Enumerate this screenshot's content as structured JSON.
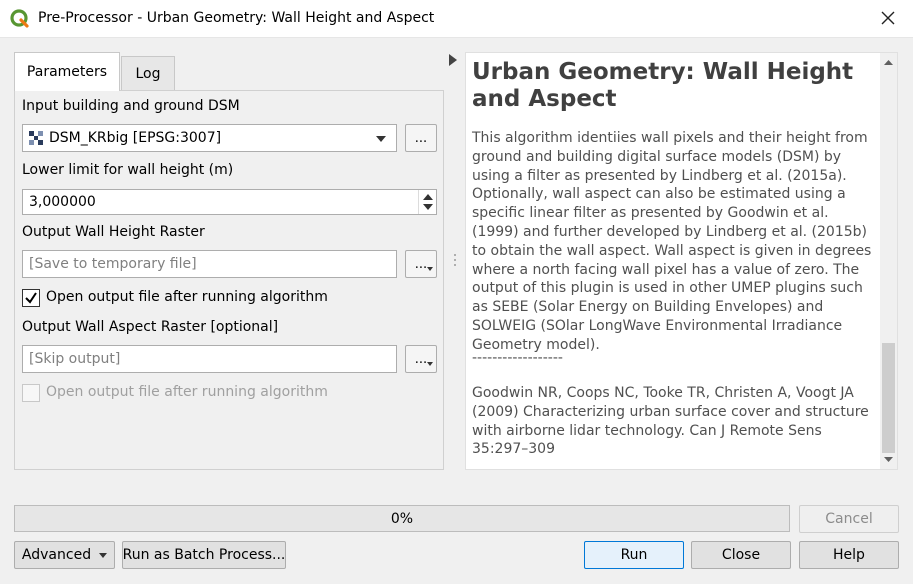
{
  "window": {
    "title": "Pre-Processor - Urban Geometry: Wall Height and Aspect"
  },
  "tabs": [
    {
      "label": "Parameters",
      "active": true
    },
    {
      "label": "Log",
      "active": false
    }
  ],
  "params": {
    "dsm_label": "Input building and ground DSM",
    "dsm_value": "DSM_KRbig [EPSG:3007]",
    "lower_limit_label": "Lower limit for wall height (m)",
    "lower_limit_value": "3,000000",
    "wall_height_label": "Output Wall Height Raster",
    "wall_height_placeholder": "[Save to temporary file]",
    "open_output_1": "Open output file after running algorithm",
    "wall_aspect_label": "Output Wall Aspect Raster [optional]",
    "wall_aspect_placeholder": "[Skip output]",
    "open_output_2": "Open output file after running algorithm",
    "browse_label": "..."
  },
  "help": {
    "title": "Urban Geometry: Wall Height and Aspect",
    "body": "This algorithm identiies wall pixels and their height from ground and building digital surface models (DSM) by using a filter as presented by Lindberg et al. (2015a). Optionally, wall aspect can also be estimated using a specific linear filter as presented by Goodwin et al. (1999) and further developed by Lindberg et al. (2015b) to obtain the wall aspect. Wall aspect is given in degrees where a north facing wall pixel has a value of zero. The output of this plugin is used in other UMEP plugins such as SEBE (Solar Energy on Building Envelopes) and SOLWEIG (SOlar LongWave Environmental Irradiance Geometry model).",
    "separator": "------------------",
    "reference": "Goodwin NR, Coops NC, Tooke TR, Christen A, Voogt JA (2009) Characterizing urban surface cover and structure with airborne lidar technology. Can J Remote Sens 35:297–309"
  },
  "progress": {
    "text": "0%"
  },
  "buttons": {
    "cancel": "Cancel",
    "advanced": "Advanced",
    "batch": "Run as Batch Process...",
    "run": "Run",
    "close": "Close",
    "help": "Help"
  },
  "colors": {
    "qgis_green": "#589632",
    "qgis_yellow": "#ee7913",
    "focus_blue": "#0078d7"
  }
}
